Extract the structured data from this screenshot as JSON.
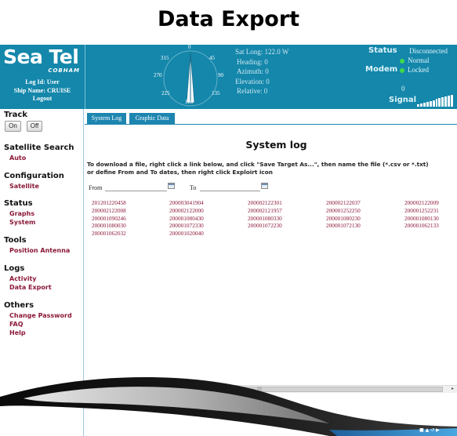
{
  "caption": "Data Export",
  "header": {
    "logo": "Sea Tel",
    "sublogo": "COBHAM",
    "log_id": "Log Id: User",
    "ship_name": "Ship Name: CRUISE",
    "logout": "Logout",
    "compass": {
      "n": "0",
      "ne": "45",
      "e": "90",
      "se": "135",
      "s": "180",
      "sw": "225",
      "w": "270",
      "nw": "315"
    },
    "antenna": {
      "sat_long": "Sat Long: 122.0 W",
      "heading": "Heading: 0",
      "azimuth": "Azimuth: 0",
      "elevation": "Elevation: 0",
      "relative": "Relative: 0"
    },
    "status": {
      "status_label": "Status",
      "status_value": "Disconnected",
      "normal": "Normal",
      "modem_label": "Modem",
      "modem_value": "Locked",
      "signal_value": "0",
      "signal_label": "Signal"
    }
  },
  "sidebar": {
    "track_title": "Track",
    "track_on": "On",
    "track_off": "Off",
    "satellite_search": "Satellite Search",
    "auto": "Auto",
    "configuration": "Configuration",
    "satellite": "Satellite",
    "status": "Status",
    "graphs": "Graphs",
    "system": "System",
    "tools": "Tools",
    "position_antenna": "Position Antenna",
    "logs": "Logs",
    "activity": "Activity",
    "data_export": "Data Export",
    "others": "Others",
    "change_password": "Change Password",
    "faq": "FAQ",
    "help": "Help"
  },
  "tabs": {
    "system_log": "System Log",
    "graphic_data": "Graphic Data"
  },
  "main": {
    "title": "System log",
    "instruction_1": "To download a file, right click a link below, and click \"Save Target As...\", then name the file (*.csv or *.txt)",
    "instruction_2": "or define From and To dates, then right click Exploirt icon",
    "from_label": "From",
    "to_label": "To",
    "files": [
      "201201220458",
      "200003041904",
      "200002122301",
      "200002122037",
      "200002122009",
      "200002122008",
      "200002122000",
      "200002121957",
      "200001252250",
      "200001252231",
      "200001090246",
      "200001080430",
      "200001080330",
      "200001080230",
      "200001080130",
      "200001080030",
      "200001072330",
      "200001072230",
      "200001072130",
      "200001062133",
      "200001062032",
      "200001020040"
    ]
  },
  "colors": {
    "header_bg": "#1487ab",
    "tab_bg": "#1d86b0",
    "link": "#8b1838"
  },
  "signal_bars": 12
}
